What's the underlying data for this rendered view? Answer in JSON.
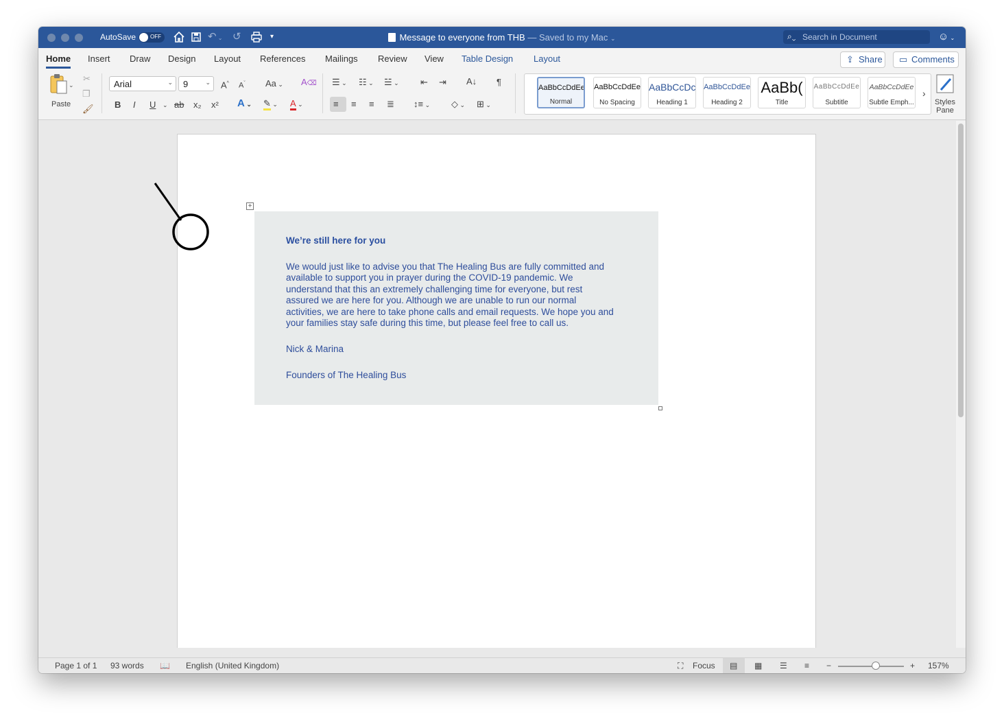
{
  "titlebar": {
    "autosave_label": "AutoSave",
    "autosave_state": "OFF",
    "doc_name": "Message to everyone from THB",
    "saved_status": "— Saved to my Mac ",
    "search_placeholder": "Search in Document"
  },
  "tabs": {
    "home": "Home",
    "insert": "Insert",
    "draw": "Draw",
    "design": "Design",
    "layout": "Layout",
    "references": "References",
    "mailings": "Mailings",
    "review": "Review",
    "view": "View",
    "table_design": "Table Design",
    "table_layout": "Layout",
    "share": "Share",
    "comments": "Comments"
  },
  "ribbon": {
    "paste_label": "Paste",
    "font_name": "Arial",
    "font_size": "9",
    "bold": "B",
    "italic": "I",
    "underline": "U",
    "strike": "ab",
    "subscript": "x₂",
    "superscript": "x²",
    "change_case": "Aa",
    "styles_pane_label": "Styles\nPane",
    "styles": [
      {
        "name": "Normal",
        "sample": "AaBbCcDdEe"
      },
      {
        "name": "No Spacing",
        "sample": "AaBbCcDdEe"
      },
      {
        "name": "Heading 1",
        "sample": "AaBbCcDc"
      },
      {
        "name": "Heading 2",
        "sample": "AaBbCcDdEe"
      },
      {
        "name": "Title",
        "sample": "AaBb("
      },
      {
        "name": "Subtitle",
        "sample": "AaBbCcDdEe"
      },
      {
        "name": "Subtle Emph...",
        "sample": "AaBbCcDdEe"
      }
    ]
  },
  "document": {
    "heading": "We’re still here for you",
    "body_lines": [
      "We would just like to advise you that The Healing Bus are fully committed and",
      "available to support you in prayer during the COVID-19 pandemic. We",
      "understand that this an extremely challenging time for everyone, but rest",
      "assured we are here for you.  Although we are unable to run our normal",
      "activities, we are here to take phone calls and email requests.  We hope you and",
      "your families stay safe during this time, but please feel free to call us."
    ],
    "signature": "Nick & Marina",
    "org": "Founders of The Healing Bus"
  },
  "status": {
    "page": "Page 1 of 1",
    "words": "93 words",
    "language": "English (United Kingdom)",
    "focus": "Focus",
    "zoom": "157%"
  },
  "icons": {
    "home": "home-icon",
    "save": "save-icon",
    "undo": "undo-icon",
    "redo": "redo-icon",
    "print": "print-icon",
    "search": "search-icon",
    "smiley": "feedback-smiley-icon"
  },
  "colors": {
    "titlebar": "#2b579a",
    "doc_text": "#2e4d9b",
    "textbox_fill": "#e8ebeb"
  }
}
